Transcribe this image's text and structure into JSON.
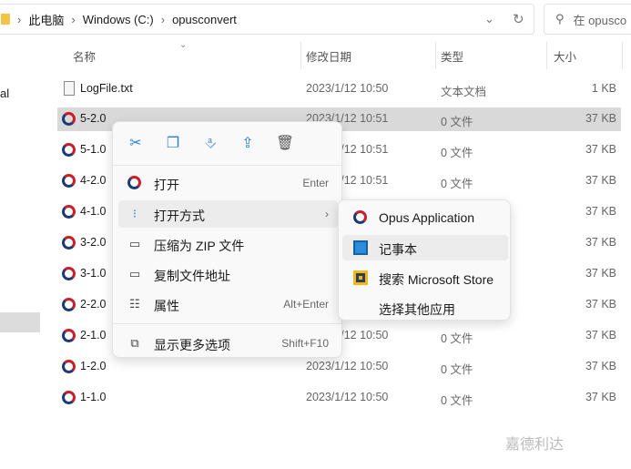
{
  "address": {
    "crumbs": [
      "此电脑",
      "Windows (C:)",
      "opusconvert"
    ]
  },
  "search": {
    "placeholder": "在 opusco"
  },
  "sidebar": {
    "partial_label": "al"
  },
  "columns": {
    "name": "名称",
    "date": "修改日期",
    "type": "类型",
    "size": "大小"
  },
  "files": [
    {
      "name": "LogFile.txt",
      "date": "2023/1/12 10:50",
      "type": "文本文档",
      "size": "1 KB",
      "icon": "text-file-icon"
    },
    {
      "name": "5-2.0",
      "date": "2023/1/12 10:51",
      "type": "0 文件",
      "size": "37 KB",
      "icon": "opus-file-icon",
      "selected": true
    },
    {
      "name": "5-1.0",
      "date": "2023/1/12 10:51",
      "type": "0 文件",
      "size": "37 KB",
      "icon": "opus-file-icon"
    },
    {
      "name": "4-2.0",
      "date": "2023/1/12 10:51",
      "type": "0 文件",
      "size": "37 KB",
      "icon": "opus-file-icon"
    },
    {
      "name": "4-1.0",
      "date": "",
      "type": "",
      "size": "37 KB",
      "icon": "opus-file-icon"
    },
    {
      "name": "3-2.0",
      "date": "",
      "type": "",
      "size": "37 KB",
      "icon": "opus-file-icon"
    },
    {
      "name": "3-1.0",
      "date": "",
      "type": "",
      "size": "37 KB",
      "icon": "opus-file-icon"
    },
    {
      "name": "2-2.0",
      "date": "",
      "type": "",
      "size": "37 KB",
      "icon": "opus-file-icon"
    },
    {
      "name": "2-1.0",
      "date": "2023/1/12 10:50",
      "type": "0 文件",
      "size": "37 KB",
      "icon": "opus-file-icon"
    },
    {
      "name": "1-2.0",
      "date": "2023/1/12 10:50",
      "type": "0 文件",
      "size": "37 KB",
      "icon": "opus-file-icon"
    },
    {
      "name": "1-1.0",
      "date": "2023/1/12 10:50",
      "type": "0 文件",
      "size": "37 KB",
      "icon": "opus-file-icon"
    }
  ],
  "context_menu": {
    "toolbar": [
      "cut-icon",
      "copy-icon",
      "rename-icon",
      "share-icon",
      "delete-icon"
    ],
    "items": [
      {
        "label": "打开",
        "shortcut": "Enter"
      },
      {
        "label": "打开方式",
        "shortcut": ""
      },
      {
        "label": "压缩为 ZIP 文件",
        "shortcut": ""
      },
      {
        "label": "复制文件地址",
        "shortcut": ""
      },
      {
        "label": "属性",
        "shortcut": "Alt+Enter"
      },
      {
        "label": "显示更多选项",
        "shortcut": "Shift+F10"
      }
    ]
  },
  "submenu": {
    "items": [
      {
        "label": "Opus Application"
      },
      {
        "label": "记事本"
      },
      {
        "label": "搜索 Microsoft Store"
      },
      {
        "label": "选择其他应用"
      }
    ]
  },
  "watermark": "嘉德利达",
  "colors": {
    "selection": "#d9d9d9",
    "accent": "#2a7fd4"
  }
}
